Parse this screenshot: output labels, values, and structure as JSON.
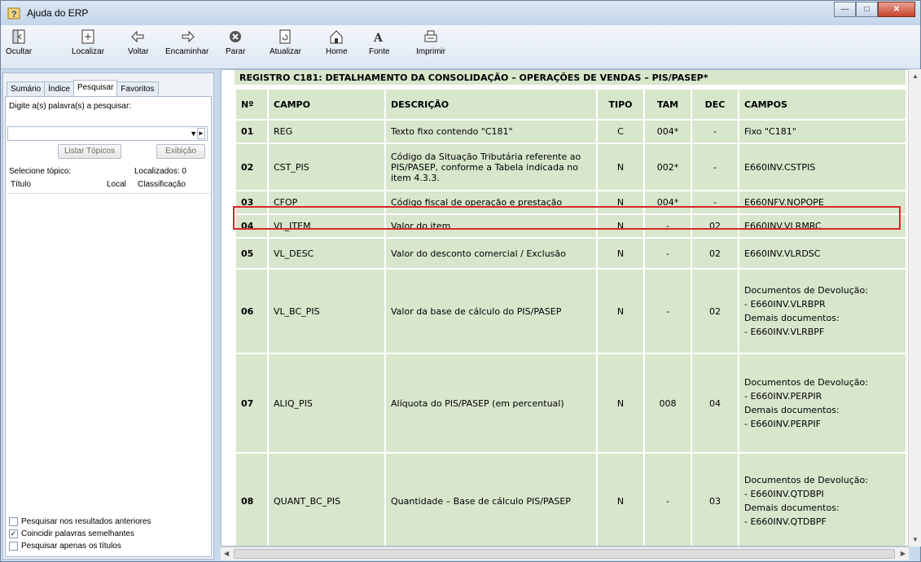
{
  "window": {
    "title": "Ajuda do ERP"
  },
  "toolbar": {
    "buttons": [
      {
        "label": "Ocultar",
        "icon": "hide-icon"
      },
      {
        "label": "Localizar",
        "icon": "locate-icon"
      },
      {
        "label": "Voltar",
        "icon": "back-arrow-icon"
      },
      {
        "label": "Encaminhar",
        "icon": "forward-arrow-icon"
      },
      {
        "label": "Parar",
        "icon": "stop-icon"
      },
      {
        "label": "Atualizar",
        "icon": "refresh-icon"
      },
      {
        "label": "Home",
        "icon": "home-icon"
      },
      {
        "label": "Fonte",
        "icon": "font-icon"
      },
      {
        "label": "Imprimir",
        "icon": "print-icon"
      }
    ]
  },
  "sidebar": {
    "tabs": [
      "Sumário",
      "Índice",
      "Pesquisar",
      "Favoritos"
    ],
    "active_tab": "Pesquisar",
    "search_label": "Digite a(s) palavra(s) a pesquisar:",
    "search_value": "",
    "list_topics_button": "Listar Tópicos",
    "display_button": "Exibição",
    "select_topic_label": "Selecione tópico:",
    "found_label": "Localizados: 0",
    "columns": [
      "Título",
      "Local",
      "Classificação"
    ],
    "options": [
      {
        "label": "Pesquisar nos resultados anteriores",
        "checked": false
      },
      {
        "label": "Coincidir palavras semelhantes",
        "checked": true
      },
      {
        "label": "Pesquisar apenas os títulos",
        "checked": false
      }
    ]
  },
  "content": {
    "caption": "REGISTRO C181: DETALHAMENTO DA CONSOLIDAÇÃO – OPERAÇÕES DE VENDAS – PIS/PASEP*",
    "headers": [
      "Nº",
      "CAMPO",
      "DESCRIÇÃO",
      "TIPO",
      "TAM",
      "DEC",
      "CAMPOS"
    ],
    "rows": [
      {
        "n": "01",
        "campo": "REG",
        "descricao": "Texto fixo contendo \"C181\"",
        "tipo": "C",
        "tam": "004*",
        "dec": "-",
        "campos": [
          "Fixo \"C181\""
        ]
      },
      {
        "n": "02",
        "campo": "CST_PIS",
        "descricao": "Código da Situação Tributária referente ao PIS/PASEP, conforme a Tabela indicada no item 4.3.3.",
        "tipo": "N",
        "tam": "002*",
        "dec": "-",
        "campos": [
          "E660INV.CSTPIS"
        ]
      },
      {
        "n": "03",
        "campo": "CFOP",
        "descricao": "Código fiscal de operação e prestação",
        "tipo": "N",
        "tam": "004*",
        "dec": "-",
        "campos": [
          "E660NFV.NOPOPE"
        ]
      },
      {
        "n": "04",
        "campo": "VL_ITEM",
        "descricao": "Valor do item",
        "tipo": "N",
        "tam": "-",
        "dec": "02",
        "campos": [
          "E660INV.VLRMRC"
        ]
      },
      {
        "n": "05",
        "campo": "VL_DESC",
        "descricao": "Valor do desconto comercial / Exclusão",
        "tipo": "N",
        "tam": "-",
        "dec": "02",
        "campos": [
          "E660INV.VLRDSC"
        ]
      },
      {
        "n": "06",
        "campo": "VL_BC_PIS",
        "descricao": "Valor da base de cálculo do PIS/PASEP",
        "tipo": "N",
        "tam": "-",
        "dec": "02",
        "campos": [
          "Documentos de Devolução:",
          "- E660INV.VLRBPR",
          "Demais documentos:",
          "- E660INV.VLRBPF"
        ]
      },
      {
        "n": "07",
        "campo": "ALIQ_PIS",
        "descricao": "Alíquota do PIS/PASEP (em percentual)",
        "tipo": "N",
        "tam": "008",
        "dec": "04",
        "campos": [
          "Documentos de Devolução:",
          "- E660INV.PERPIR",
          "Demais documentos:",
          "- E660INV.PERPIF"
        ]
      },
      {
        "n": "08",
        "campo": "QUANT_BC_PIS",
        "descricao": "Quantidade – Base de cálculo PIS/PASEP",
        "tipo": "N",
        "tam": "-",
        "dec": "03",
        "campos": [
          "Documentos de Devolução:",
          "- E660INV.QTDBPI",
          "Demais documentos:",
          "- E660INV.QTDBPF"
        ]
      }
    ],
    "highlight_color": "#d9272d"
  }
}
